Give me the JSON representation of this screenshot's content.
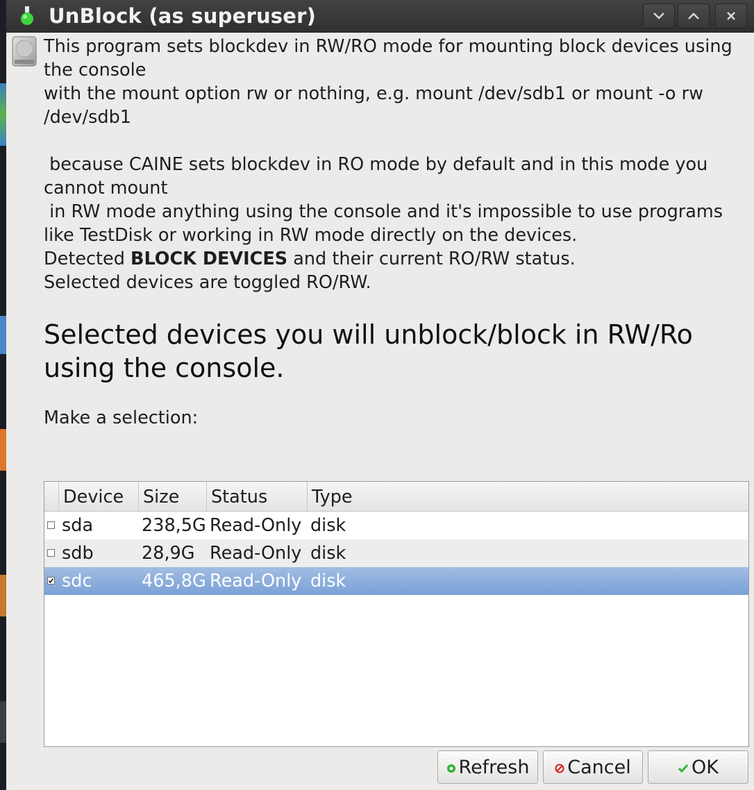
{
  "window": {
    "title": "UnBlock (as superuser)",
    "controls": [
      "minimize",
      "maximize",
      "close"
    ]
  },
  "message": {
    "line1": "This program sets blockdev in RW/RO mode for mounting block devices using the console",
    "line2": "with the mount option rw or nothing, e.g. mount /dev/sdb1 or mount -o rw /dev/sdb1",
    "line3": " because CAINE sets blockdev in RO mode by default and in this mode you cannot mount",
    "line4": " in RW mode anything using the console and it's impossible to use programs like TestDisk or working in RW mode directly on the devices.",
    "line5_pre": "Detected ",
    "line5_bold": "BLOCK DEVICES",
    "line5_post": " and their current RO/RW status.",
    "line6": "Selected devices are toggled RO/RW."
  },
  "heading": "Selected devices you will unblock/block in RW/Ro using the console.",
  "prompt": "Make a selection:",
  "table": {
    "columns": [
      "Device",
      "Size",
      "Status",
      "Type"
    ],
    "rows": [
      {
        "checked": false,
        "device": "sda",
        "size": "238,5G",
        "status": "Read-Only",
        "type": "disk"
      },
      {
        "checked": false,
        "device": "sdb",
        "size": "28,9G",
        "status": "Read-Only",
        "type": "disk"
      },
      {
        "checked": true,
        "device": "sdc",
        "size": "465,8G",
        "status": "Read-Only",
        "type": "disk"
      }
    ]
  },
  "buttons": {
    "refresh": "Refresh",
    "cancel": "Cancel",
    "ok": "OK"
  },
  "icons": {
    "app": "green-flask-icon",
    "dialog": "drive-harddisk-icon",
    "refresh": "green-dot-icon",
    "cancel": "cancel-icon",
    "ok": "checkmark-icon"
  },
  "colors": {
    "titlebar": "#363636",
    "selection": "#8eafdc",
    "refresh_icon": "#2fb52f",
    "cancel_icon": "#d81e1e",
    "ok_icon": "#2fb52f"
  }
}
